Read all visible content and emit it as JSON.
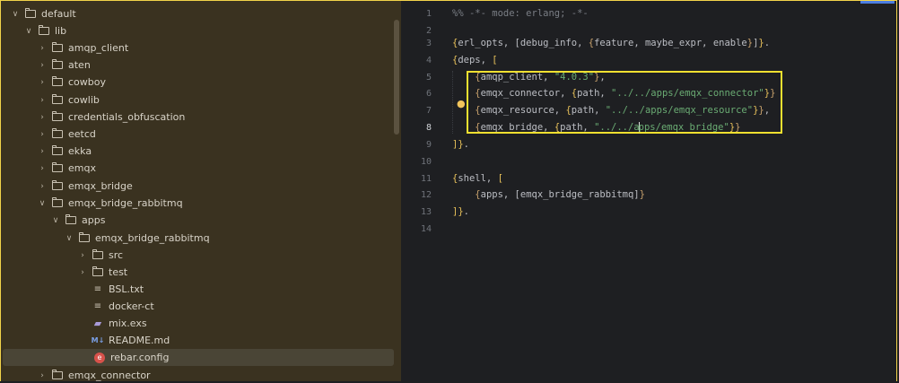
{
  "project_tree": {
    "items": [
      {
        "label": "default",
        "depth": 0,
        "kind": "folder",
        "expanded": true
      },
      {
        "label": "lib",
        "depth": 1,
        "kind": "folder",
        "expanded": true
      },
      {
        "label": "amqp_client",
        "depth": 2,
        "kind": "folder",
        "expanded": false
      },
      {
        "label": "aten",
        "depth": 2,
        "kind": "folder",
        "expanded": false
      },
      {
        "label": "cowboy",
        "depth": 2,
        "kind": "folder",
        "expanded": false
      },
      {
        "label": "cowlib",
        "depth": 2,
        "kind": "folder",
        "expanded": false
      },
      {
        "label": "credentials_obfuscation",
        "depth": 2,
        "kind": "folder",
        "expanded": false
      },
      {
        "label": "eetcd",
        "depth": 2,
        "kind": "folder",
        "expanded": false
      },
      {
        "label": "ekka",
        "depth": 2,
        "kind": "folder",
        "expanded": false
      },
      {
        "label": "emqx",
        "depth": 2,
        "kind": "folder",
        "expanded": false
      },
      {
        "label": "emqx_bridge",
        "depth": 2,
        "kind": "folder",
        "expanded": false
      },
      {
        "label": "emqx_bridge_rabbitmq",
        "depth": 2,
        "kind": "folder",
        "expanded": true
      },
      {
        "label": "apps",
        "depth": 3,
        "kind": "folder",
        "expanded": true
      },
      {
        "label": "emqx_bridge_rabbitmq",
        "depth": 4,
        "kind": "folder",
        "expanded": true
      },
      {
        "label": "src",
        "depth": 5,
        "kind": "folder",
        "expanded": false
      },
      {
        "label": "test",
        "depth": 5,
        "kind": "folder",
        "expanded": false
      },
      {
        "label": "BSL.txt",
        "depth": 5,
        "kind": "text"
      },
      {
        "label": "docker-ct",
        "depth": 5,
        "kind": "text"
      },
      {
        "label": "mix.exs",
        "depth": 5,
        "kind": "elixir"
      },
      {
        "label": "README.md",
        "depth": 5,
        "kind": "markdown"
      },
      {
        "label": "rebar.config",
        "depth": 5,
        "kind": "erlang",
        "selected": true
      },
      {
        "label": "emqx_connector",
        "depth": 2,
        "kind": "folder",
        "expanded": false
      }
    ]
  },
  "editor": {
    "active_line": 8,
    "line_numbers": [
      "1",
      "2",
      "3",
      "4",
      "5",
      "6",
      "7",
      "8",
      "9",
      "10",
      "11",
      "12",
      "13",
      "14"
    ],
    "lines": {
      "l1": "%% -*- mode: erlang; -*-",
      "l3a": "{",
      "l3b": "erl_opts, [debug_info, ",
      "l3c": "{",
      "l3d": "feature, maybe_expr, enable",
      "l3e": "}",
      "l3f": "]",
      "l3g": "}",
      "l3h": ".",
      "l4a": "{",
      "l4b": "deps, ",
      "l5a": "{",
      "l5b": "amqp_client, ",
      "l5c": "\"4.0.3\"",
      "l5d": "}",
      "l5e": ",",
      "l6a": "{",
      "l6b": "emqx_connector, ",
      "l6c": "{",
      "l6d": "path, ",
      "l6e": "\"../../apps/emqx_connector\"",
      "l6f": "}",
      "l6g": "}",
      "l7a": "{",
      "l7b": "emqx_resource, ",
      "l7c": "{",
      "l7d": "path, ",
      "l7e": "\"../../apps/emqx_resource\"",
      "l7f": "}",
      "l7g": "}",
      "l7h": ",",
      "l8a": "{",
      "l8b": "emqx_bridge, ",
      "l8c": "{",
      "l8d": "path, ",
      "l8e1": "\"../../a",
      "l8e2": "pps/emqx_bridge\"",
      "l8f": "}",
      "l8g": "}",
      "l9a": "]",
      "l9b": "}",
      "l9c": ".",
      "l11a": "{",
      "l11b": "shell, ",
      "l12a": "{",
      "l12b": "apps, [emqx_bridge_rabbitmq]",
      "l12c": "}",
      "l13a": "]",
      "l13b": "}",
      "l13c": "."
    }
  },
  "colors": {
    "highlight": "#f0e030",
    "string": "#6aab73",
    "brace": "#e7c05a",
    "comment": "#7a7e85"
  }
}
